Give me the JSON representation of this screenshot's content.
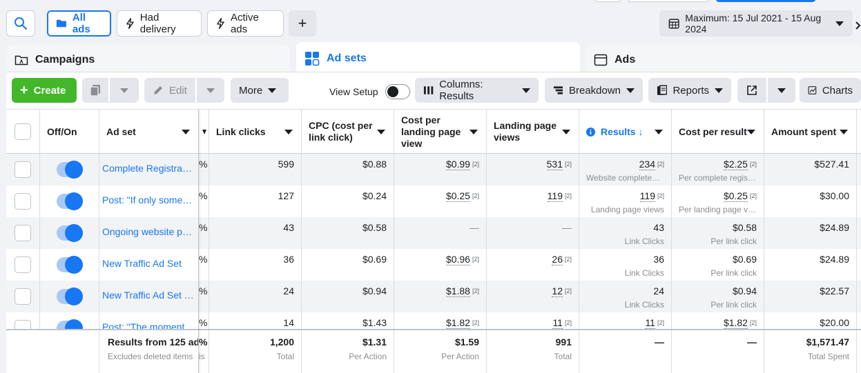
{
  "filters": {
    "all_ads": "All ads",
    "had_delivery": "Had delivery",
    "active_ads": "Active ads",
    "add": "+",
    "date_range": "Maximum: 15 Jul 2021 - 15 Aug 2024"
  },
  "tabs": {
    "campaigns": "Campaigns",
    "ad_sets": "Ad sets",
    "ads": "Ads"
  },
  "toolbar": {
    "create": "Create",
    "edit": "Edit",
    "more": "More",
    "view_setup": "View Setup",
    "columns": "Columns: Results",
    "breakdown": "Breakdown",
    "reports": "Reports",
    "charts": "Charts"
  },
  "columns": {
    "off_on": "Off/On",
    "ad_set": "Ad set",
    "link_clicks": "Link clicks",
    "cpc": "CPC (cost per link click)",
    "cost_per_lpv": "Cost per landing page view",
    "lpv": "Landing page views",
    "results": "Results ↓",
    "cost_per_result": "Cost per result",
    "amount_spent": "Amount spent"
  },
  "rows": [
    {
      "name": "Complete Registration",
      "clipped": "%",
      "link_clicks": "599",
      "cpc": "$0.88",
      "cost_lpv": "$0.99",
      "cost_lpv_fn": "[2]",
      "lpv": "531",
      "lpv_fn": "[2]",
      "results": "234",
      "results_fn": "[2]",
      "results_sub": "Website completed registrations",
      "cpr": "$2.25",
      "cpr_fn": "[2]",
      "cpr_sub": "Per complete registration",
      "spent": "$527.41"
    },
    {
      "name": "Post: \"If only someone told me\"",
      "clipped": "%",
      "link_clicks": "127",
      "cpc": "$0.24",
      "cost_lpv": "$0.25",
      "cost_lpv_fn": "[2]",
      "lpv": "119",
      "lpv_fn": "[2]",
      "results": "119",
      "results_fn": "[2]",
      "results_sub": "Landing page views",
      "cpr": "$0.25",
      "cpr_fn": "[2]",
      "cpr_sub": "Per landing page view",
      "spent": "$30.00"
    },
    {
      "name": "Ongoing website promotion",
      "clipped": "%",
      "link_clicks": "43",
      "cpc": "$0.58",
      "cost_lpv": "—",
      "lpv": "—",
      "results": "43",
      "results_sub": "Link Clicks",
      "cpr": "$0.58",
      "cpr_sub": "Per link click",
      "spent": "$24.89"
    },
    {
      "name": "New Traffic Ad Set",
      "clipped": "%",
      "link_clicks": "36",
      "cpc": "$0.69",
      "cost_lpv": "$0.96",
      "cost_lpv_fn": "[2]",
      "lpv": "26",
      "lpv_fn": "[2]",
      "results": "36",
      "results_sub": "Link Clicks",
      "cpr": "$0.69",
      "cpr_sub": "Per link click",
      "spent": "$24.89"
    },
    {
      "name": "New Traffic Ad Set - Copy",
      "clipped": "%",
      "link_clicks": "24",
      "cpc": "$0.94",
      "cost_lpv": "$1.88",
      "cost_lpv_fn": "[2]",
      "lpv": "12",
      "lpv_fn": "[2]",
      "results": "24",
      "results_sub": "Link Clicks",
      "cpr": "$0.94",
      "cpr_sub": "Per link click",
      "spent": "$22.57"
    },
    {
      "name": "Post: \"The moment",
      "clipped": "%",
      "link_clicks": "14",
      "cpc": "$1.43",
      "cost_lpv": "$1.82",
      "cost_lpv_fn": "[2]",
      "lpv": "11",
      "lpv_fn": "[2]",
      "results": "11",
      "results_fn": "[2]",
      "results_sub": "",
      "cpr": "$1.82",
      "cpr_fn": "[2]",
      "cpr_sub": "",
      "spent": "$20.00"
    }
  ],
  "footer": {
    "title": "Results from 125 ad",
    "clipped": "%",
    "subtitle": "Excludes deleted items",
    "clipped_sub": "is",
    "link_clicks": "1,200",
    "link_clicks_sub": "Total",
    "cpc": "$1.31",
    "cpc_sub": "Per Action",
    "cost_lpv": "$1.59",
    "cost_lpv_sub": "Per Action",
    "lpv": "991",
    "lpv_sub": "Total",
    "results": "—",
    "cpr": "—",
    "spent": "$1,571.47",
    "spent_sub": "Total Spent"
  },
  "colors": {
    "accent": "#1877f2",
    "create_green": "#42b72a"
  }
}
